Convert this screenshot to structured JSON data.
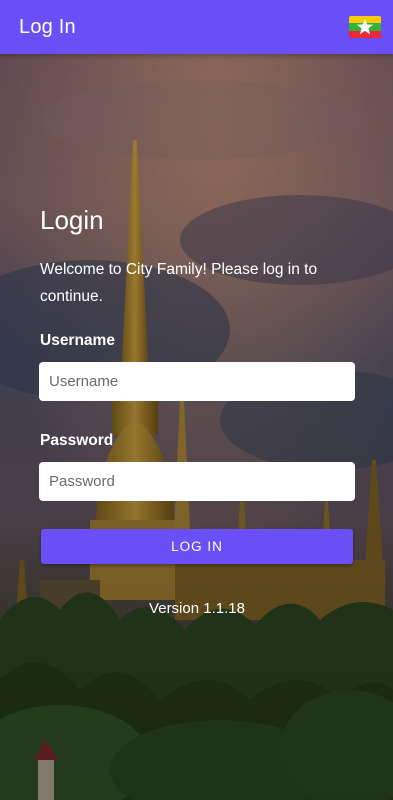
{
  "appbar": {
    "title": "Log In",
    "flag_icon": "myanmar-flag-icon",
    "color": "#6a4ff6"
  },
  "login": {
    "heading": "Login",
    "welcome": "Welcome to City Family! Please log in to continue.",
    "username_label": "Username",
    "username_placeholder": "Username",
    "username_value": "",
    "password_label": "Password",
    "password_placeholder": "Password",
    "password_value": "",
    "button_label": "LOG IN",
    "version": "Version 1.1.18"
  }
}
